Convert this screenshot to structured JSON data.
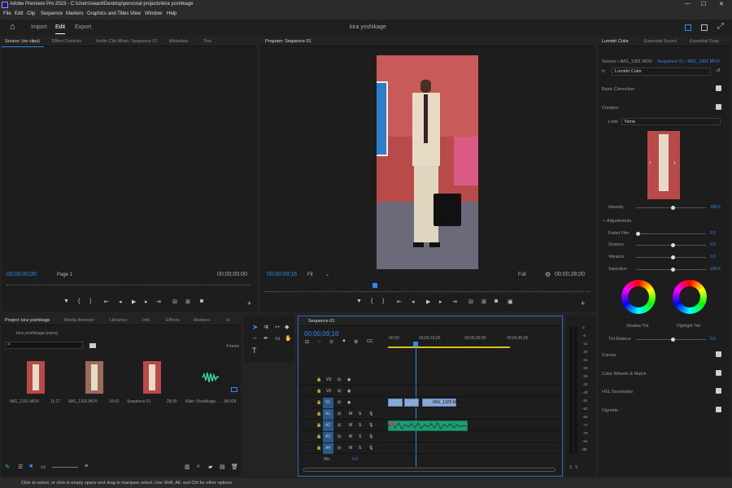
{
  "window": {
    "title": "Adobe Premiere Pro 2023 - C:\\Users\\seant\\Desktop\\personal projects\\kira yoshikage",
    "controls": {
      "minimize": "—",
      "maximize": "☐",
      "close": "✕"
    }
  },
  "menu": [
    "File",
    "Edit",
    "Clip",
    "Sequence",
    "Markers",
    "Graphics and Titles",
    "View",
    "Window",
    "Help"
  ],
  "header": {
    "home": "⌂",
    "import": "Import",
    "edit": "Edit",
    "export": "Export",
    "project_name": "kira yoshikage"
  },
  "source_panel": {
    "tabs": [
      "Source: (no clips)",
      "Effect Controls",
      "Audio Clip Mixer: Sequence 01",
      "Metadata",
      "Text"
    ],
    "timecode": "00;00;00;00",
    "timecode_end": "00;00;00;00",
    "page": "Page 1"
  },
  "program_panel": {
    "tab": "Program: Sequence 01",
    "timecode": "00;00;09;16",
    "fit": "Fit",
    "quality": "Full",
    "duration": "00;00;28;00"
  },
  "project_panel": {
    "tabs": [
      "Project: kira yoshikage",
      "Media Browser",
      "Libraries",
      "Info",
      "Effects",
      "Markers",
      "H"
    ],
    "file": "kira yoshikage.prproj",
    "count": "4 items",
    "items": [
      {
        "name": "IMG_1301.MOV",
        "duration": "11:27"
      },
      {
        "name": "IMG_1325.MOV",
        "duration": "16:02"
      },
      {
        "name": "Sequence 01",
        "duration": "28:00"
      },
      {
        "name": "Killer (Yoshikage...",
        "duration": "28:028"
      }
    ]
  },
  "timeline": {
    "tab": "Sequence 01",
    "timecode": "00;00;09;16",
    "ruler": [
      ":00:00",
      "00;00;15;00",
      "00;00;30;00",
      "00;00;45;00"
    ],
    "video_tracks": [
      "V3",
      "V2",
      "V1"
    ],
    "audio_tracks": [
      "A1",
      "A2",
      "A3",
      "A4"
    ],
    "mix": "Mix",
    "mix_value": "0.0",
    "clip_label": "IMG_1325.M",
    "toggle_m": "M",
    "toggle_s": "S"
  },
  "meters": {
    "scale": [
      "0",
      "-6",
      "-12",
      "-18",
      "-24",
      "-30",
      "-36",
      "-42",
      "-48",
      "-54",
      "-60",
      "-66",
      "-72",
      "-78",
      "-84",
      "dB"
    ],
    "solo": "S",
    "solo2": "S"
  },
  "lumetri": {
    "tabs": [
      "Lumetri Color",
      "Essential Sound",
      "Essential Grap"
    ],
    "source": "Source • IMG_1301.MOV",
    "seq": "Sequence 01 • IMG_1301.MOV",
    "fx": "Lumetri Color",
    "sections": {
      "basic": "Basic Correction",
      "creative": "Creative",
      "adjustments": "Adjustments",
      "curves": "Curves",
      "wheels": "Color Wheels & Match",
      "hsl": "HSL Secondary",
      "vignette": "Vignette"
    },
    "look_label": "Look",
    "look_value": "None",
    "intensity_label": "Intensity",
    "intensity_value": "100.0",
    "sliders": [
      {
        "label": "Faded Film",
        "value": "0.0",
        "level": 0
      },
      {
        "label": "Sharpen",
        "value": "0.0",
        "level": 0.5
      },
      {
        "label": "Vibrance",
        "value": "0.0",
        "level": 0.5
      },
      {
        "label": "Saturation",
        "value": "100.0",
        "level": 0.5
      }
    ],
    "shadow_tint": "Shadow Tint",
    "highlight_tint": "Highlight Tint",
    "tint_balance": "Tint Balance",
    "tint_value": "0.0"
  },
  "status": "Click to select, or click in empty space and drag to marquee select. Use Shift, Alt, and Ctrl for other options."
}
